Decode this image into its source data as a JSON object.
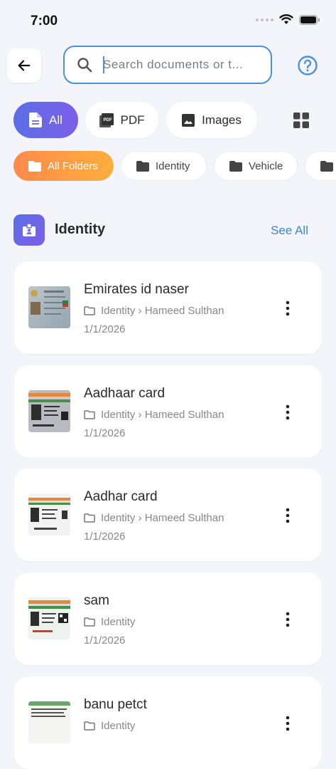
{
  "status": {
    "time": "7:00"
  },
  "search": {
    "placeholder": "Search documents or t..."
  },
  "type_filters": [
    {
      "label": "All",
      "icon": "document-icon",
      "active": true
    },
    {
      "label": "PDF",
      "icon": "pdf-icon",
      "active": false
    },
    {
      "label": "Images",
      "icon": "image-icon",
      "active": false
    }
  ],
  "folders": [
    {
      "label": "All Folders",
      "active": true
    },
    {
      "label": "Identity",
      "active": false
    },
    {
      "label": "Vehicle",
      "active": false
    }
  ],
  "section": {
    "title": "Identity",
    "see_all": "See All"
  },
  "documents": [
    {
      "title": "Emirates id naser",
      "path": "Identity › Hameed Sulthan",
      "date": "1/1/2026"
    },
    {
      "title": "Aadhaar card",
      "path": "Identity › Hameed Sulthan",
      "date": "1/1/2026"
    },
    {
      "title": "Aadhar card",
      "path": "Identity › Hameed Sulthan",
      "date": "1/1/2026"
    },
    {
      "title": "sam",
      "path": "Identity",
      "date": "1/1/2026"
    },
    {
      "title": "banu petct",
      "path": "Identity",
      "date": ""
    }
  ],
  "colors": {
    "accent_blue": "#4a8fe0",
    "chip_gradient_start": "#5b6fe6",
    "chip_gradient_end": "#7d5ee8",
    "folder_gradient_start": "#ff8a4c",
    "folder_gradient_end": "#ffae3c"
  }
}
